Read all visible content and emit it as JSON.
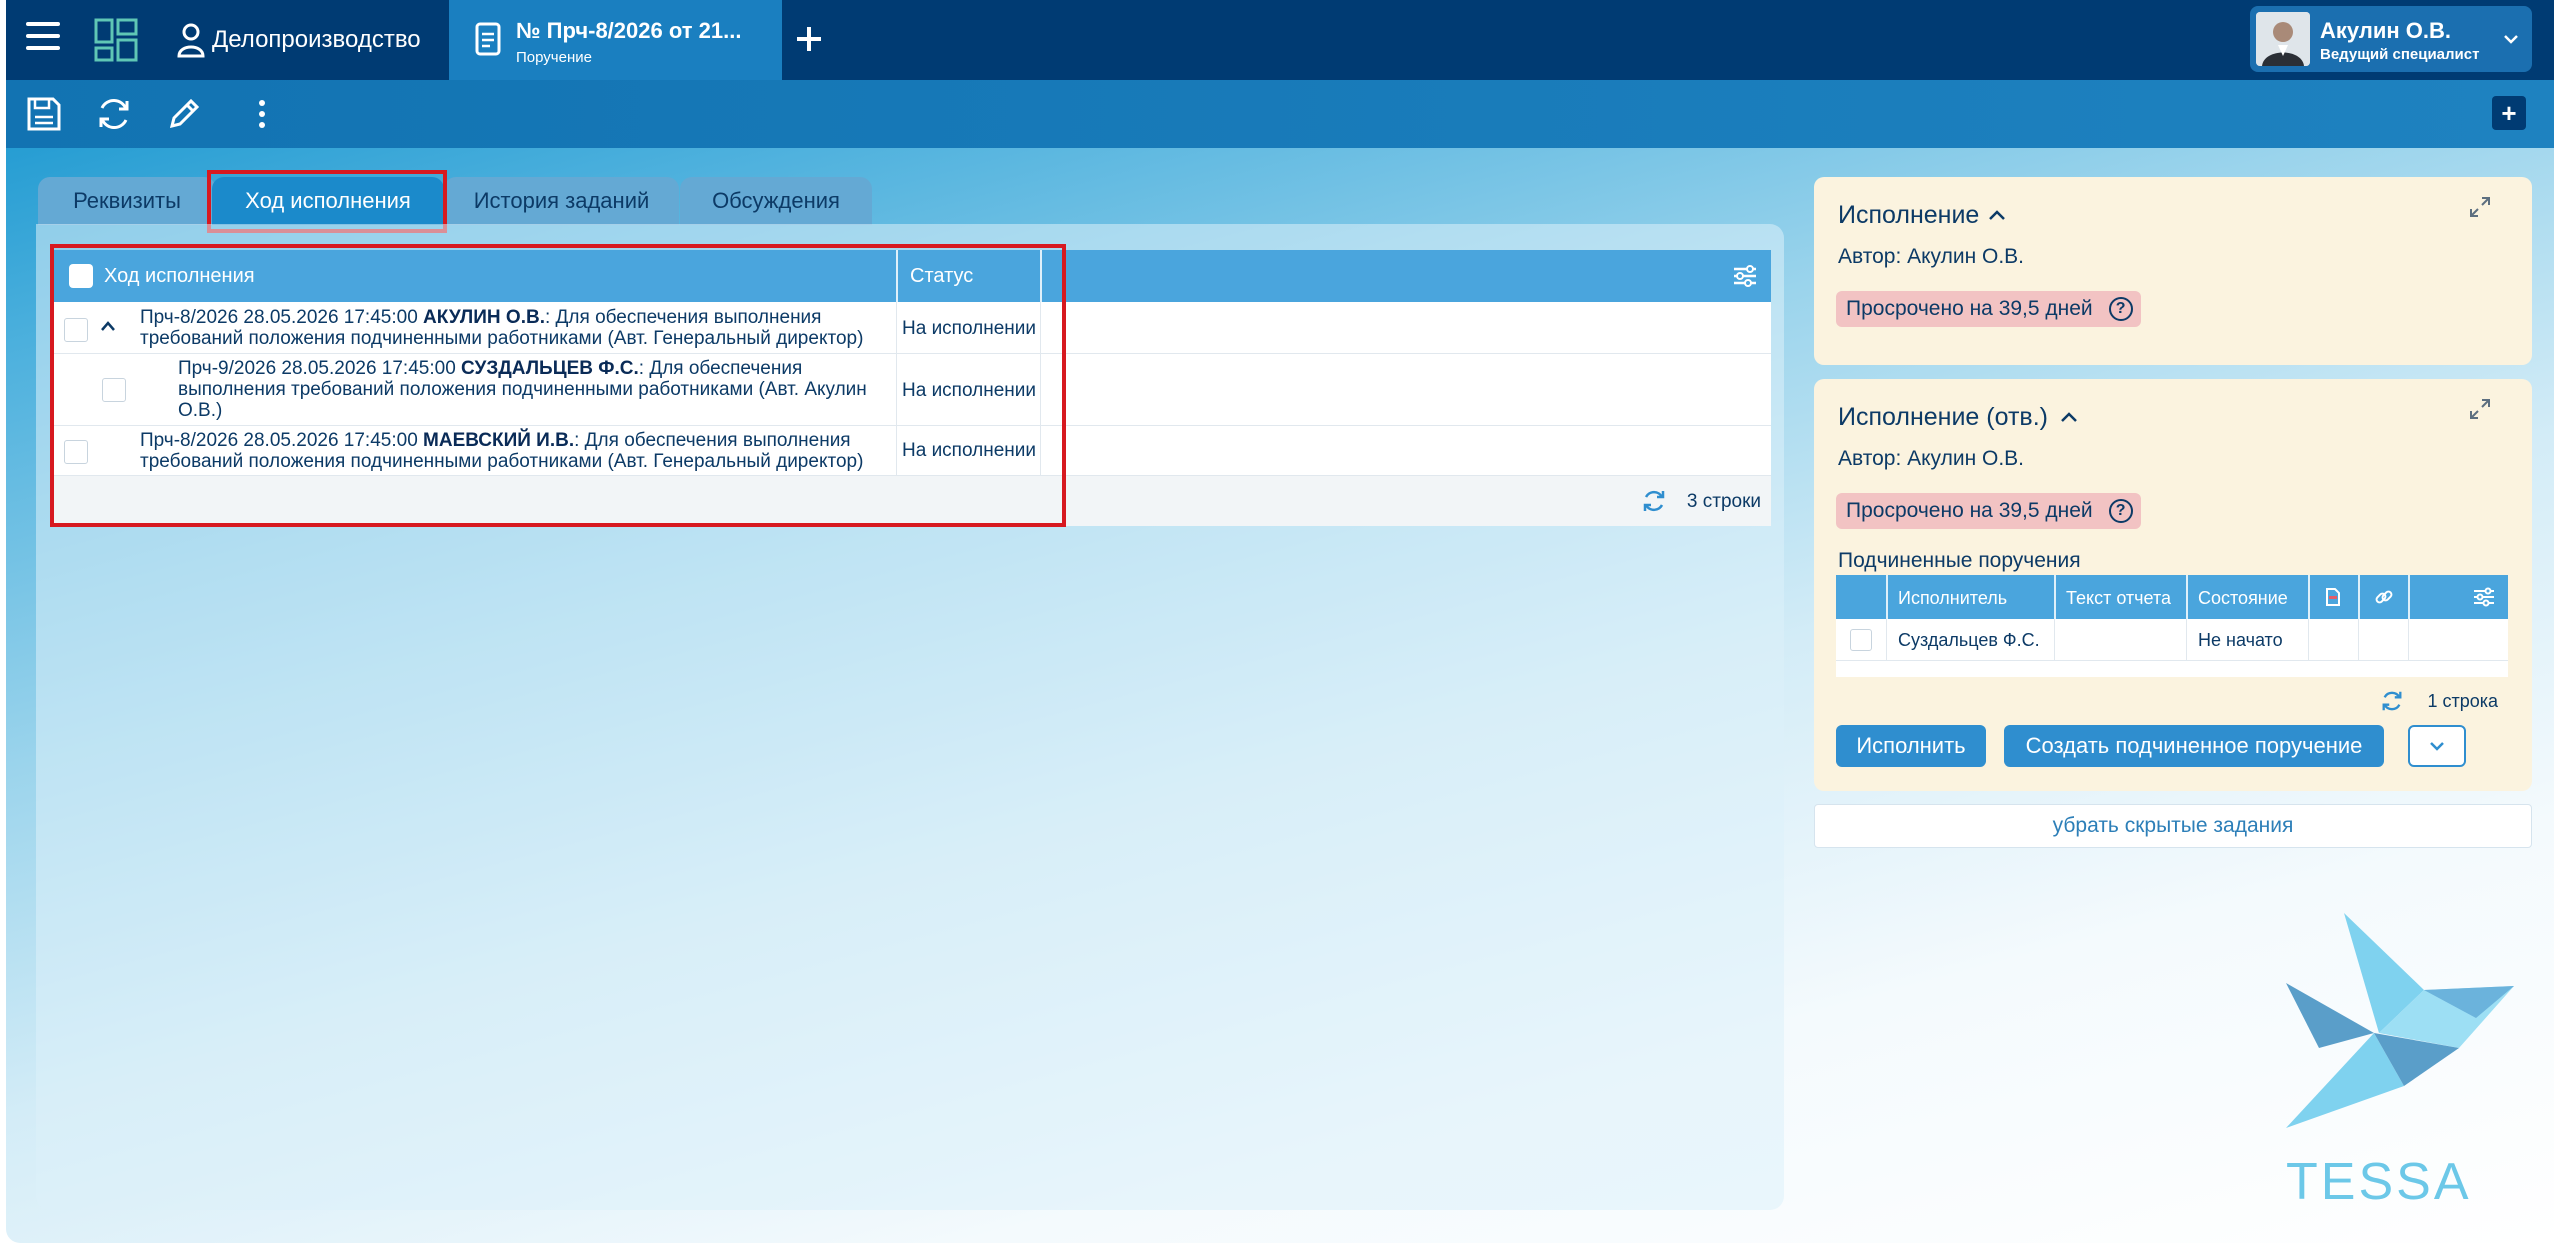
{
  "header": {
    "app_title": "Делопроизводство",
    "doc_tab": {
      "title": "№ Прч-8/2026 от 21...",
      "subtitle": "Поручение"
    },
    "user": {
      "name": "Акулин О.В.",
      "role": "Ведущий специалист"
    }
  },
  "tabs": [
    {
      "label": "Реквизиты"
    },
    {
      "label": "Ход исполнения"
    },
    {
      "label": "История заданий"
    },
    {
      "label": "Обсуждения"
    }
  ],
  "progress_grid": {
    "columns": [
      "Ход исполнения",
      "Статус"
    ],
    "rows": [
      {
        "prefix": "Прч-8/2026 28.05.2026 17:45:00",
        "person": "АКУЛИН О.В.",
        "line1_rest": ": Для обеспечения выполнения",
        "line2": "требований положения подчиненными работниками (Авт. Генеральный директор)",
        "status": "На исполнении"
      },
      {
        "prefix": "Прч-9/2026 28.05.2026 17:45:00",
        "person": "СУЗДАЛЬЦЕВ Ф.С.",
        "line1_rest": ": Для обеспечения",
        "line2": "выполнения требований положения подчиненными работниками (Авт. Акулин",
        "line3": "О.В.)",
        "status": "На исполнении"
      },
      {
        "prefix": "Прч-8/2026 28.05.2026 17:45:00",
        "person": "МАЕВСКИЙ И.В.",
        "line1_rest": ": Для обеспечения выполнения",
        "line2": "требований положения подчиненными работниками (Авт. Генеральный директор)",
        "status": "На исполнении"
      }
    ],
    "footer_count": "3 строки"
  },
  "card_execution": {
    "title": "Исполнение",
    "author": "Автор: Акулин О.В.",
    "overdue": "Просрочено на 39,5 дней",
    "help": "?"
  },
  "card_execution_resp": {
    "title": "Исполнение (отв.)",
    "author": "Автор: Акулин О.В.",
    "overdue": "Просрочено на 39,5 дней",
    "help": "?",
    "sub_title": "Подчиненные поручения",
    "sub_columns": [
      "Исполнитель",
      "Текст отчета",
      "Состояние"
    ],
    "sub_rows": [
      {
        "executor": "Суздальцев Ф.С.",
        "report": "",
        "state": "Не начато"
      }
    ],
    "sub_count": "1 строка",
    "btn_execute": "Исполнить",
    "btn_create_sub": "Создать подчиненное поручение"
  },
  "hide_tasks_link": "убрать скрытые задания",
  "logo_text": "TESSA",
  "colors": {
    "header_bg": "#003b73",
    "accent": "#2f8ecf",
    "card_bg": "#fbf3df",
    "overdue_bg": "#f2c3c3",
    "highlight": "#d71920"
  }
}
